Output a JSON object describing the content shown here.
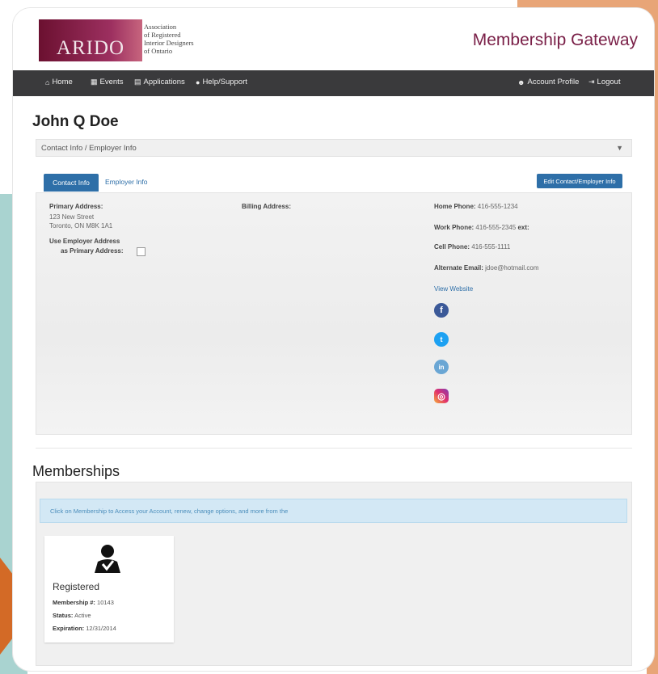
{
  "header": {
    "logo_text": "ARIDO",
    "logo_subtitle": [
      "Association",
      "of Registered",
      "Interior Designers",
      "of Ontario"
    ],
    "site_title": "Membership Gateway"
  },
  "nav": {
    "left": [
      {
        "label": "Home",
        "icon": "home-icon"
      },
      {
        "label": "Events",
        "icon": "calendar-icon"
      },
      {
        "label": "Applications",
        "icon": "grid-icon"
      },
      {
        "label": "Help/Support",
        "icon": "help-icon"
      }
    ],
    "right": [
      {
        "label": "Account Profile",
        "icon": "user-icon"
      },
      {
        "label": "Logout",
        "icon": "logout-icon"
      }
    ]
  },
  "profile": {
    "name": "John Q Doe",
    "accordion_title": "Contact Info / Employer Info",
    "tabs": [
      "Contact Info",
      "Employer Info"
    ],
    "edit_button": "Edit Contact/Employer Info"
  },
  "contact": {
    "primary_address_label": "Primary Address:",
    "primary_address_line1": "123 New Street",
    "primary_address_line2": "Toronto, ON M8K 1A1",
    "use_employer_label_line1": "Use Employer Address",
    "use_employer_label_line2": "as Primary Address:",
    "billing_address_label": "Billing Address:",
    "home_phone_label": "Home Phone:",
    "home_phone": "416-555-1234",
    "work_phone_label": "Work Phone:",
    "work_phone": "416-555-2345",
    "ext_label": "ext:",
    "cell_phone_label": "Cell Phone:",
    "cell_phone": "416-555-1111",
    "alt_email_label": "Alternate Email:",
    "alt_email": "jdoe@hotmail.com",
    "website_link": "View Website"
  },
  "memberships": {
    "section_title": "Memberships",
    "alert_text": "Click on Membership to Access your Account, renew, change options, and more from the",
    "card": {
      "title": "Registered",
      "membership_label": "Membership #:",
      "membership_number": "10143",
      "status_label": "Status:",
      "status_value": "Active",
      "expiration_label": "Expiration:",
      "expiration_value": "12/31/2014"
    }
  },
  "colors": {
    "brand": "#7a2048",
    "primary_button": "#2e6fa8",
    "navbar": "#3a3a3c"
  }
}
